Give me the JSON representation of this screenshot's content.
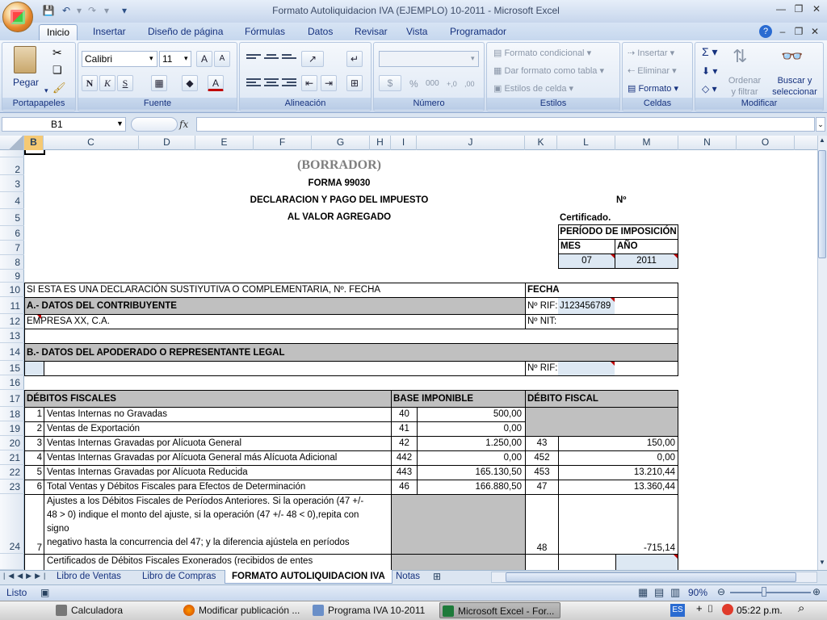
{
  "window": {
    "title": "Formato Autoliquidacion IVA (EJEMPLO) 10-2011 - Microsoft Excel"
  },
  "ribbon": {
    "tabs": [
      "Inicio",
      "Insertar",
      "Diseño de página",
      "Fórmulas",
      "Datos",
      "Revisar",
      "Vista",
      "Programador"
    ],
    "active_tab": "Inicio",
    "portapapeles": {
      "paste": "Pegar",
      "label": "Portapapeles"
    },
    "fuente": {
      "font": "Calibri",
      "size": "11",
      "label": "Fuente",
      "bold": "N",
      "italic": "K",
      "underline": "S",
      "grow": "A",
      "shrink": "A",
      "color": "A"
    },
    "alineacion": {
      "label": "Alineación"
    },
    "numero": {
      "label": "Número",
      "percent": "%",
      "thousands": "000",
      "inc": "+,0",
      "dec": ",00"
    },
    "estilos": {
      "label": "Estilos",
      "cond": "Formato condicional",
      "table": "Dar formato como tabla",
      "cell": "Estilos de celda"
    },
    "celdas": {
      "label": "Celdas",
      "insert": "Insertar",
      "delete": "Eliminar",
      "format": "Formato"
    },
    "modificar": {
      "label": "Modificar",
      "sum": "Σ",
      "sort1": "Ordenar",
      "sort2": "y filtrar",
      "find1": "Buscar y",
      "find2": "seleccionar"
    }
  },
  "formula_bar": {
    "name_box": "B1",
    "fx": "fx",
    "formula": ""
  },
  "columns": [
    "B",
    "C",
    "D",
    "E",
    "F",
    "G",
    "H",
    "I",
    "J",
    "K",
    "L",
    "M",
    "N",
    "O"
  ],
  "rows": [
    "2",
    "3",
    "4",
    "5",
    "6",
    "7",
    "8",
    "9",
    "10",
    "11",
    "12",
    "13",
    "14",
    "15",
    "16",
    "17",
    "18",
    "19",
    "20",
    "21",
    "22",
    "23",
    "24"
  ],
  "doc": {
    "borrador": "(BORRADOR)",
    "forma": "FORMA 99030",
    "decl1": "DECLARACION Y PAGO DEL IMPUESTO",
    "decl2": "AL VALOR AGREGADO",
    "num": "Nº",
    "cert": "Certificado.",
    "periodo": "PERÍODO DE IMPOSICIÓN",
    "mes": "MES",
    "anio": "AÑO",
    "mes_val": "07",
    "anio_val": "2011",
    "sustitutiva": "SI ESTA ES UNA DECLARACIÓN SUSTIYUTIVA O COMPLEMENTARIA, Nº. FECHA",
    "fecha": "FECHA",
    "secA": "A.- DATOS DEL CONTRIBUYENTE",
    "rif": "Nº RIF:",
    "rif_val": "J123456789",
    "empresa": "EMPRESA XX, C.A.",
    "nit": "Nº NIT:",
    "secB": "B.- DATOS DEL APODERADO O REPRESENTANTE LEGAL",
    "rif2": "Nº RIF:",
    "debitos": "DÉBITOS FISCALES",
    "base": "BASE IMPONIBLE",
    "debito": "DÉBITO FISCAL",
    "lines": [
      {
        "n": "1",
        "desc": "Ventas Internas no Gravadas",
        "code": "40",
        "base": "500,00",
        "code2": "",
        "deb": ""
      },
      {
        "n": "2",
        "desc": "Ventas de Exportación",
        "code": "41",
        "base": "0,00",
        "code2": "",
        "deb": ""
      },
      {
        "n": "3",
        "desc": "Ventas Internas Gravadas por Alícuota General",
        "code": "42",
        "base": "1.250,00",
        "code2": "43",
        "deb": "150,00"
      },
      {
        "n": "4",
        "desc": "Ventas Internas Gravadas por Alícuota General más Alícuota Adicional",
        "code": "442",
        "base": "0,00",
        "code2": "452",
        "deb": "0,00"
      },
      {
        "n": "5",
        "desc": "Ventas Internas Gravadas por Alícuota Reducida",
        "code": "443",
        "base": "165.130,50",
        "code2": "453",
        "deb": "13.210,44"
      },
      {
        "n": "6",
        "desc": "Total Ventas y Débitos Fiscales para Efectos de Determinación",
        "code": "46",
        "base": "166.880,50",
        "code2": "47",
        "deb": "13.360,44"
      }
    ],
    "ajuste_n": "7",
    "ajuste1": "Ajustes a los Débitos Fiscales de Períodos Anteriores. Si la operación (47 +/-",
    "ajuste2": "48 > 0) indique el monto del ajuste, si la operación (47 +/- 48 < 0),repita con",
    "ajuste3": "signo",
    "ajuste4": "negativo hasta la concurrencia del 47; y la diferencia ajústela en períodos",
    "ajuste_code": "48",
    "ajuste_val": "-715,14",
    "cert_line": "Certificados de Débitos Fiscales Exonerados (recibidos de entes"
  },
  "sheets": [
    "Libro de Ventas",
    "Libro de Compras",
    "FORMATO AUTOLIQUIDACION IVA",
    "Notas"
  ],
  "status": {
    "ready": "Listo",
    "zoom": "90%"
  },
  "taskbar": {
    "items": [
      "Calculadora",
      "Modificar publicación ...",
      "Programa IVA 10-2011",
      "Microsoft Excel - For..."
    ],
    "lang": "ES",
    "time": "05:22 p.m."
  }
}
